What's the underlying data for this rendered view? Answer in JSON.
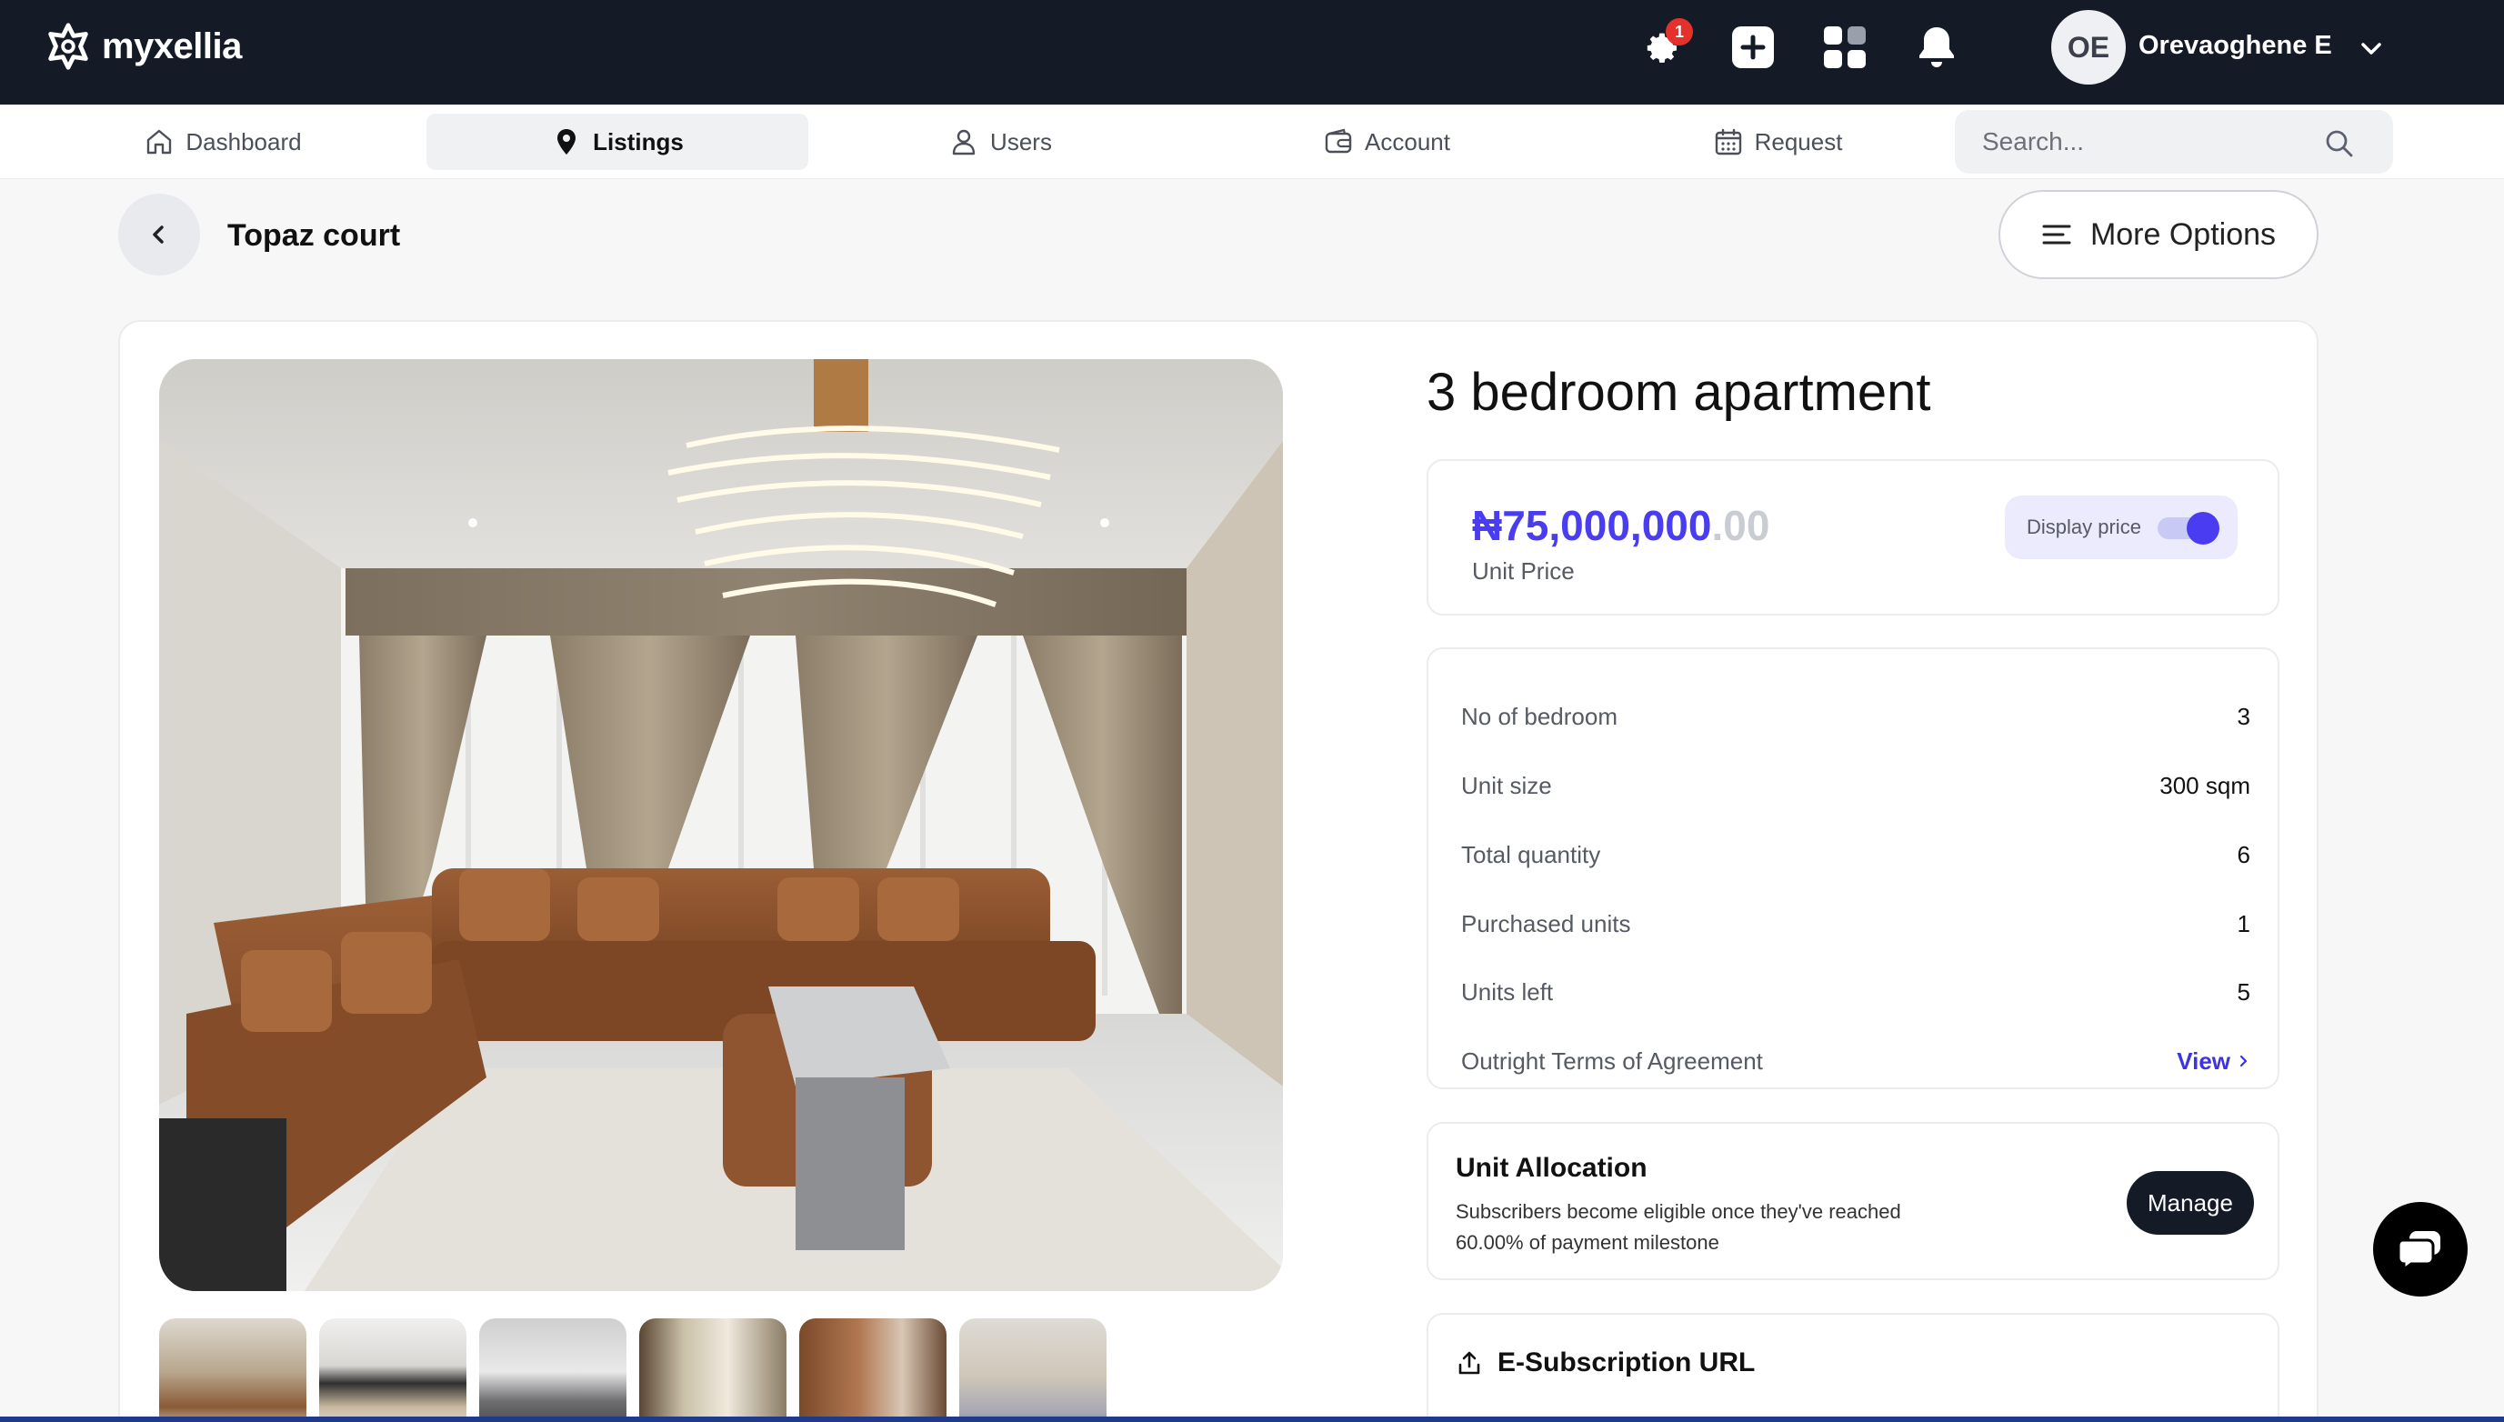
{
  "app": {
    "name": "myxellia",
    "notification_count": "1"
  },
  "user": {
    "initials": "OE",
    "name": "Orevaoghene E"
  },
  "nav": {
    "items": [
      {
        "label": "Dashboard",
        "icon": "home-icon"
      },
      {
        "label": "Listings",
        "icon": "location-pin-icon",
        "active": true
      },
      {
        "label": "Users",
        "icon": "user-icon"
      },
      {
        "label": "Account",
        "icon": "wallet-icon"
      },
      {
        "label": "Request",
        "icon": "calendar-icon"
      }
    ],
    "search_placeholder": "Search..."
  },
  "header": {
    "title": "Topaz court",
    "more_options": "More Options"
  },
  "listing": {
    "title": "3 bedroom apartment",
    "price_main": "₦75,000,000",
    "price_cents": ".00",
    "price_label": "Unit Price",
    "display_price_label": "Display price",
    "display_price_on": true,
    "details": [
      {
        "label": "No of bedroom",
        "value": "3"
      },
      {
        "label": "Unit size",
        "value": "300 sqm"
      },
      {
        "label": "Total quantity",
        "value": "6"
      },
      {
        "label": "Purchased units",
        "value": "1"
      },
      {
        "label": "Units left",
        "value": "5"
      },
      {
        "label": "Outright Terms of Agreement",
        "value": "View"
      }
    ],
    "allocation": {
      "title": "Unit Allocation",
      "description": "Subscribers become eligible once they've reached 60.00% of payment milestone",
      "button": "Manage"
    },
    "esubscription": {
      "title": "E-Subscription URL"
    }
  },
  "colors": {
    "topbar": "#141b27",
    "accent": "#4a3cf0",
    "badge": "#e5312b"
  }
}
